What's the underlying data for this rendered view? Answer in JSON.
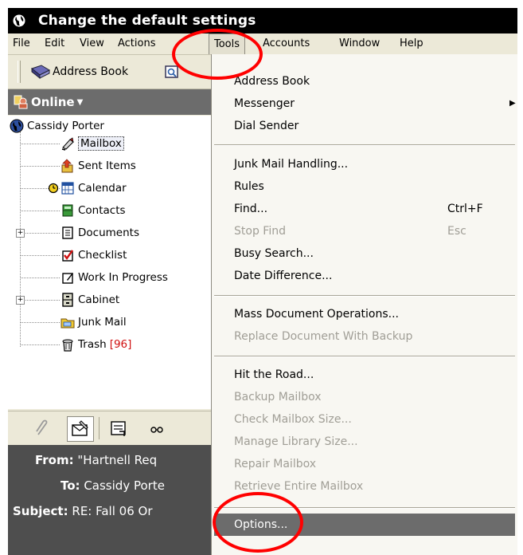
{
  "window": {
    "title": "Change the default settings"
  },
  "menubar": [
    {
      "label": "File"
    },
    {
      "label": "Edit"
    },
    {
      "label": "View"
    },
    {
      "label": "Actions"
    },
    {
      "label": "Tools"
    },
    {
      "label": "Accounts"
    },
    {
      "label": "Window"
    },
    {
      "label": "Help"
    }
  ],
  "toolbar": {
    "address_book": "Address Book"
  },
  "status": {
    "online": "Online"
  },
  "tree": {
    "root": "Cassidy Porter",
    "items": [
      {
        "label": "Mailbox",
        "icon": "mailbox-icon"
      },
      {
        "label": "Sent Items",
        "icon": "sent-items-icon"
      },
      {
        "label": "Calendar",
        "icon": "calendar-icon"
      },
      {
        "label": "Contacts",
        "icon": "contacts-icon"
      },
      {
        "label": "Documents",
        "icon": "documents-icon"
      },
      {
        "label": "Checklist",
        "icon": "checklist-icon"
      },
      {
        "label": "Work In Progress",
        "icon": "work-in-progress-icon"
      },
      {
        "label": "Cabinet",
        "icon": "cabinet-icon"
      },
      {
        "label": "Junk Mail",
        "icon": "junk-mail-icon"
      },
      {
        "label": "Trash",
        "icon": "trash-icon",
        "badge": "[96]"
      }
    ]
  },
  "preview": {
    "from_label": "From:",
    "from_value": "\"Hartnell Req",
    "to_label": "To:",
    "to_value": "Cassidy Porte",
    "subject_label": "Subject:",
    "subject_value": "RE: Fall 06 Or"
  },
  "tools_menu": {
    "address_book": "Address Book",
    "messenger": "Messenger",
    "dial_sender": "Dial Sender",
    "junk_mail": "Junk Mail Handling...",
    "rules": "Rules",
    "find": "Find...",
    "find_shortcut": "Ctrl+F",
    "stop_find": "Stop Find",
    "stop_find_shortcut": "Esc",
    "busy_search": "Busy Search...",
    "date_difference": "Date Difference...",
    "mass_doc_ops": "Mass Document Operations...",
    "replace_doc": "Replace Document With Backup",
    "hit_the_road": "Hit the Road...",
    "backup_mailbox": "Backup Mailbox",
    "check_mailbox": "Check Mailbox Size...",
    "manage_library": "Manage Library Size...",
    "repair_mailbox": "Repair Mailbox",
    "retrieve_mailbox": "Retrieve Entire Mailbox",
    "options": "Options..."
  },
  "colors": {
    "highlight": "#ff0000",
    "titlebar": "#000000",
    "menu_highlight": "#6c6c6c",
    "trash_count": "#d01010"
  }
}
